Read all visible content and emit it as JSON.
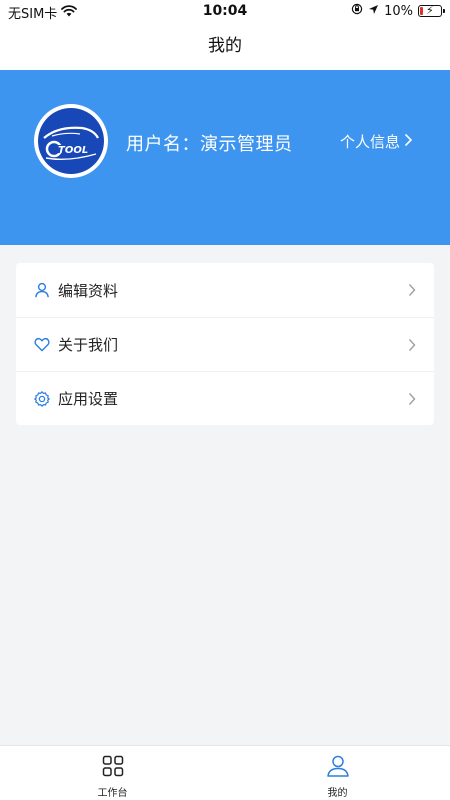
{
  "status_bar": {
    "carrier": "无SIM卡",
    "time": "10:04",
    "battery": "10%"
  },
  "nav": {
    "title": "我的"
  },
  "profile": {
    "username": "用户名：演示管理员",
    "link_label": "个人信息"
  },
  "menu": {
    "items": [
      {
        "label": "编辑资料",
        "icon": "user-icon"
      },
      {
        "label": "关于我们",
        "icon": "heart-icon"
      },
      {
        "label": "应用设置",
        "icon": "gear-icon"
      }
    ]
  },
  "tabbar": {
    "tabs": [
      {
        "label": "工作台",
        "icon": "grid-icon",
        "active": false
      },
      {
        "label": "我的",
        "icon": "user-icon",
        "active": true
      }
    ]
  },
  "colors": {
    "header": "#3d95f0",
    "accent": "#2d7ee0",
    "page_bg": "#f3f4f6"
  }
}
